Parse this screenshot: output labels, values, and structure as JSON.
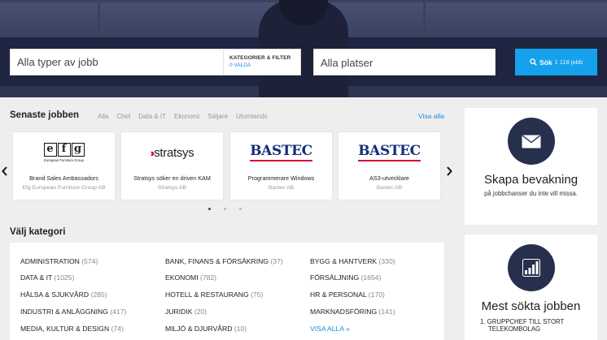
{
  "search": {
    "job_placeholder": "Alla typer av jobb",
    "category_filter_label": "KATEGORIER & FILTER",
    "category_filter_selected": "0 VALDA",
    "place_placeholder": "Alla platser",
    "button_label": "Sök",
    "button_count": "1 118 jobb"
  },
  "latest": {
    "title": "Senaste jobben",
    "filters": [
      "Alla",
      "Chef",
      "Data & IT",
      "Ekonomi",
      "Säljare",
      "Utomlands"
    ],
    "view_all": "Visa alla",
    "prev": "‹",
    "next": "›",
    "cards": [
      {
        "logo": "efg",
        "logo_sub": "European Furniture Group",
        "title": "Brand Sales Ambassadors",
        "company": "Efg European Furniture Group AB"
      },
      {
        "logo": "stratsys",
        "logo_text": "stratsys",
        "title": "Stratsys söker en driven KAM",
        "company": "Stratsys AB"
      },
      {
        "logo": "bastec",
        "logo_text": "BASTEC",
        "title": "Programmerare Windows",
        "company": "Bastec AB"
      },
      {
        "logo": "bastec",
        "logo_text": "BASTEC",
        "title": "AS3-utvecklare",
        "company": "Bastec AB"
      }
    ],
    "page_dots": 3,
    "active_dot": 0
  },
  "categories": {
    "title": "Välj kategori",
    "items": [
      {
        "name": "ADMINISTRATION",
        "count": "(574)"
      },
      {
        "name": "BANK, FINANS & FÖRSÄKRING",
        "count": "(37)"
      },
      {
        "name": "BYGG & HANTVERK",
        "count": "(330)"
      },
      {
        "name": "DATA & IT",
        "count": "(1025)"
      },
      {
        "name": "EKONOMI",
        "count": "(782)"
      },
      {
        "name": "FÖRSÄLJNING",
        "count": "(1654)"
      },
      {
        "name": "HÄLSA & SJUKVÅRD",
        "count": "(285)"
      },
      {
        "name": "HOTELL & RESTAURANG",
        "count": "(75)"
      },
      {
        "name": "HR & PERSONAL",
        "count": "(170)"
      },
      {
        "name": "INDUSTRI & ANLÄGGNING",
        "count": "(417)"
      },
      {
        "name": "JURIDIK",
        "count": "(20)"
      },
      {
        "name": "MARKNADSFÖRING",
        "count": "(141)"
      },
      {
        "name": "MEDIA, KULTUR & DESIGN",
        "count": "(74)"
      },
      {
        "name": "MILJÖ & DJURVÅRD",
        "count": "(10)"
      }
    ],
    "view_all": "VISA ALLA »"
  },
  "sidebar": {
    "alert_title": "Skapa bevakning",
    "alert_text": "på jobbchanser du inte vill missa.",
    "most_searched_title": "Mest sökta jobben",
    "most_searched_first": "1.  GRUPPCHEF TILL STORT",
    "most_searched_first_cont": "TELEKOMBOLAG"
  },
  "colors": {
    "accent": "#16a1ec",
    "link": "#1a8ee0",
    "navy": "#26304d",
    "bastec_blue": "#142e7a",
    "brand_red": "#d0123a"
  },
  "icons": {
    "mail": "mail-icon",
    "chart": "bar-chart-icon",
    "search": "search-icon"
  }
}
